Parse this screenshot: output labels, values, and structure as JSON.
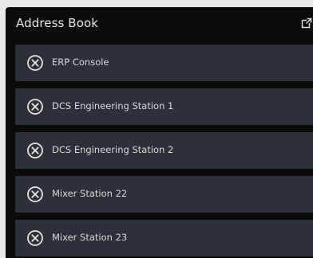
{
  "panel": {
    "title": "Address Book",
    "popout_icon": "popout-icon"
  },
  "entries": [
    {
      "label": "ERP Console",
      "icon": "remove-circle-icon"
    },
    {
      "label": "DCS Engineering Station 1",
      "icon": "remove-circle-icon"
    },
    {
      "label": "DCS Engineering Station 2",
      "icon": "remove-circle-icon"
    },
    {
      "label": "Mixer Station 22",
      "icon": "remove-circle-icon"
    },
    {
      "label": "Mixer Station 23",
      "icon": "remove-circle-icon"
    }
  ],
  "colors": {
    "panel_bg": "#0b0b0c",
    "row_bg": "#2c3138",
    "text": "#d6d8db",
    "page_bg": "#e7e8ea"
  }
}
